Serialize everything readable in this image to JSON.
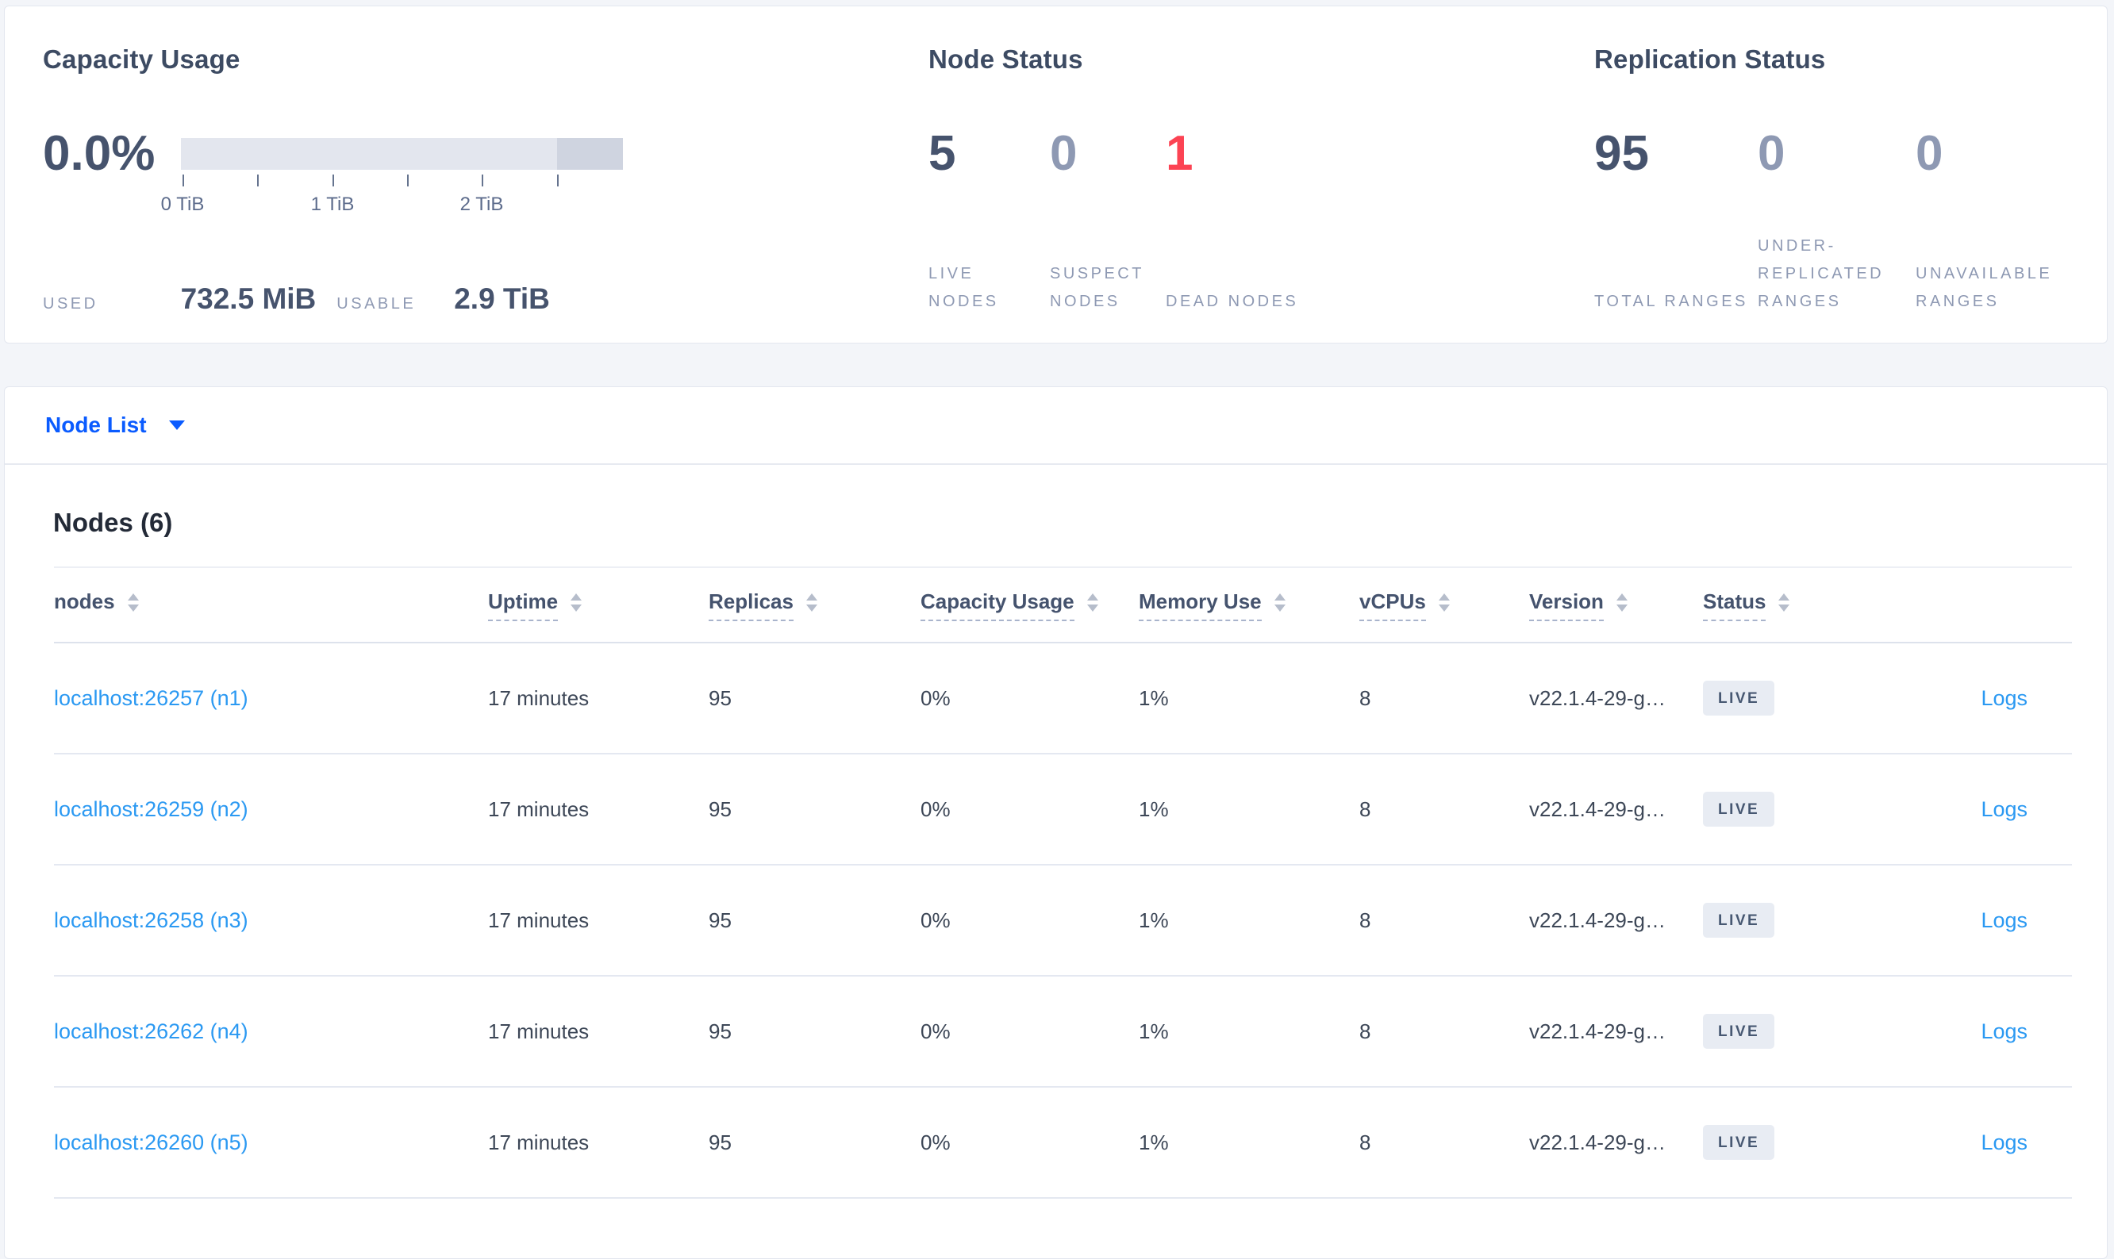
{
  "colors": {
    "page_background": "#f3f5f9",
    "card_background": "#ffffff",
    "title_text": "#3d4b63",
    "stat_number": "#46536d",
    "stat_number_muted": "#8e99b3",
    "stat_number_danger": "#fc4353",
    "stat_label": "#8e99b3",
    "bar_light": "#e3e6ee",
    "bar_dark_tail": "#cfd4e0",
    "primary_link_blue": "#0a5bff",
    "row_link_blue": "#2b99f2",
    "badge_background": "#e8ecf3",
    "row_divider": "#e4e8f1"
  },
  "overview": {
    "capacity": {
      "title": "Capacity Usage",
      "percent": "0.0%",
      "ticks": [
        "0 TiB",
        "1 TiB",
        "2 TiB"
      ],
      "used_label": "USED",
      "used_value": "732.5 MiB",
      "usable_label": "USABLE",
      "usable_value": "2.9 TiB"
    },
    "node_status": {
      "title": "Node Status",
      "stats": [
        {
          "value": "5",
          "label": "LIVE NODES"
        },
        {
          "value": "0",
          "label": "SUSPECT NODES"
        },
        {
          "value": "1",
          "label": "DEAD NODES"
        }
      ]
    },
    "replication": {
      "title": "Replication Status",
      "stats": [
        {
          "value": "95",
          "label": "TOTAL RANGES"
        },
        {
          "value": "0",
          "label": "UNDER-REPLICATED RANGES"
        },
        {
          "value": "0",
          "label": "UNAVAILABLE RANGES"
        }
      ]
    }
  },
  "view_selector": {
    "label": "Node List"
  },
  "nodes": {
    "heading": "Nodes (6)",
    "columns": [
      {
        "label": "nodes"
      },
      {
        "label": "Uptime"
      },
      {
        "label": "Replicas"
      },
      {
        "label": "Capacity Usage"
      },
      {
        "label": "Memory Use"
      },
      {
        "label": "vCPUs"
      },
      {
        "label": "Version"
      },
      {
        "label": "Status"
      },
      {
        "label": ""
      }
    ],
    "rows": [
      {
        "address": "localhost:26257 (n1)",
        "uptime": "17 minutes",
        "replicas": "95",
        "capacity_usage": "0%",
        "memory_use": "1%",
        "vcpus": "8",
        "version": "v22.1.4-29-g…",
        "status": "LIVE",
        "logs": "Logs"
      },
      {
        "address": "localhost:26259 (n2)",
        "uptime": "17 minutes",
        "replicas": "95",
        "capacity_usage": "0%",
        "memory_use": "1%",
        "vcpus": "8",
        "version": "v22.1.4-29-g…",
        "status": "LIVE",
        "logs": "Logs"
      },
      {
        "address": "localhost:26258 (n3)",
        "uptime": "17 minutes",
        "replicas": "95",
        "capacity_usage": "0%",
        "memory_use": "1%",
        "vcpus": "8",
        "version": "v22.1.4-29-g…",
        "status": "LIVE",
        "logs": "Logs"
      },
      {
        "address": "localhost:26262 (n4)",
        "uptime": "17 minutes",
        "replicas": "95",
        "capacity_usage": "0%",
        "memory_use": "1%",
        "vcpus": "8",
        "version": "v22.1.4-29-g…",
        "status": "LIVE",
        "logs": "Logs"
      },
      {
        "address": "localhost:26260 (n5)",
        "uptime": "17 minutes",
        "replicas": "95",
        "capacity_usage": "0%",
        "memory_use": "1%",
        "vcpus": "8",
        "version": "v22.1.4-29-g…",
        "status": "LIVE",
        "logs": "Logs"
      }
    ]
  }
}
